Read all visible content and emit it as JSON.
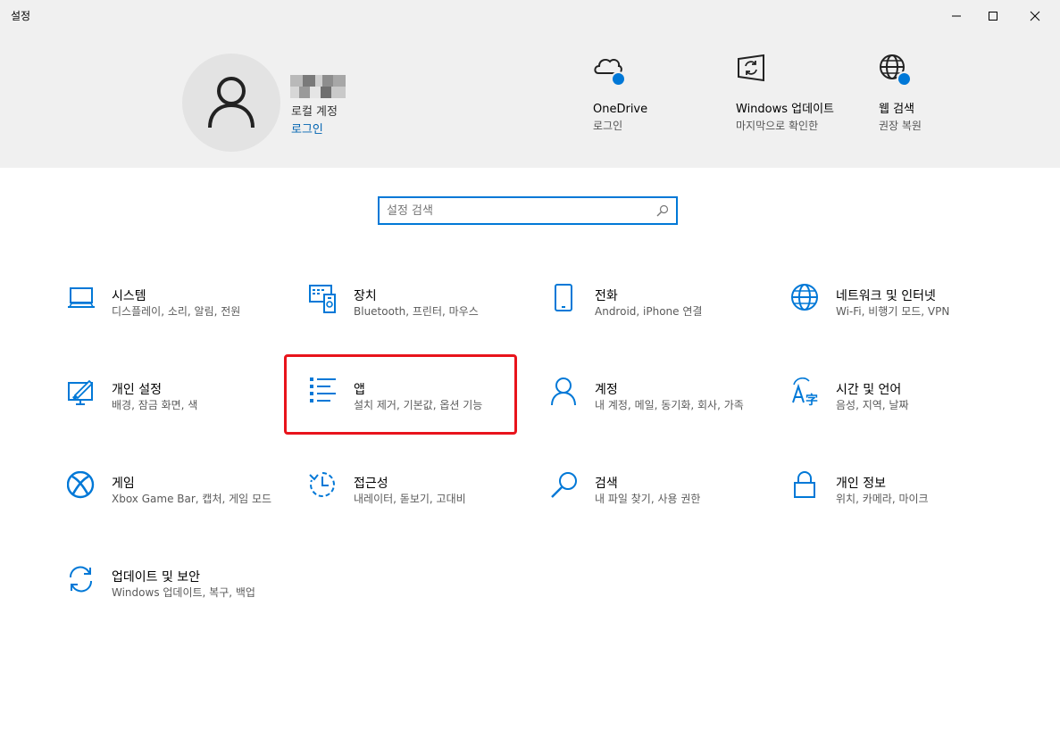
{
  "window": {
    "title": "설정"
  },
  "header": {
    "account": {
      "type": "로컬 계정",
      "login": "로그인"
    },
    "items": [
      {
        "title": "OneDrive",
        "subtitle": "로그인"
      },
      {
        "title": "Windows 업데이트",
        "subtitle": "마지막으로 확인한"
      },
      {
        "title": "웹 검색",
        "subtitle": "권장 복원"
      }
    ]
  },
  "search": {
    "placeholder": "설정 검색"
  },
  "tiles": [
    {
      "title": "시스템",
      "desc": "디스플레이, 소리, 알림, 전원",
      "icon": "laptop-icon"
    },
    {
      "title": "장치",
      "desc": "Bluetooth, 프린터, 마우스",
      "icon": "devices-icon"
    },
    {
      "title": "전화",
      "desc": "Android, iPhone 연결",
      "icon": "phone-icon"
    },
    {
      "title": "네트워크 및 인터넷",
      "desc": "Wi-Fi, 비행기 모드, VPN",
      "icon": "globe-icon"
    },
    {
      "title": "개인 설정",
      "desc": "배경, 잠금 화면, 색",
      "icon": "personalization-icon"
    },
    {
      "title": "앱",
      "desc": "설치 제거, 기본값, 옵션 기능",
      "icon": "apps-list-icon"
    },
    {
      "title": "계정",
      "desc": "내 계정, 메일, 동기화, 회사, 가족",
      "icon": "person-icon"
    },
    {
      "title": "시간 및 언어",
      "desc": "음성, 지역, 날짜",
      "icon": "time-language-icon"
    },
    {
      "title": "게임",
      "desc": "Xbox Game Bar, 캡처, 게임 모드",
      "icon": "xbox-icon"
    },
    {
      "title": "접근성",
      "desc": "내레이터, 돋보기, 고대비",
      "icon": "accessibility-icon"
    },
    {
      "title": "검색",
      "desc": "내 파일 찾기, 사용 권한",
      "icon": "search-icon"
    },
    {
      "title": "개인 정보",
      "desc": "위치, 카메라, 마이크",
      "icon": "lock-icon"
    },
    {
      "title": "업데이트 및 보안",
      "desc": "Windows 업데이트, 복구, 백업",
      "icon": "sync-icon"
    }
  ],
  "colors": {
    "accent": "#0078d7",
    "highlight": "#e8141c",
    "header_bg": "#f0f0f0"
  }
}
